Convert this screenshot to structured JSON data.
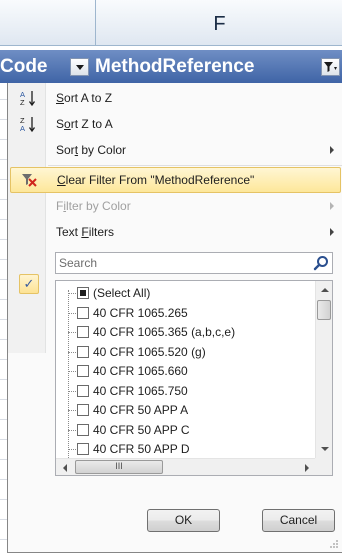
{
  "column_header": {
    "letter": "F"
  },
  "table_header": {
    "code_label": "Code",
    "method_label": "MethodReference"
  },
  "menu": {
    "sort_az": {
      "pre": "",
      "key": "S",
      "post": "ort A to Z"
    },
    "sort_za": {
      "pre": "S",
      "key": "o",
      "post": "rt Z to A"
    },
    "sort_color": {
      "pre": "Sor",
      "key": "t",
      "post": " by Color"
    },
    "clear_filter": {
      "pre": "",
      "key": "C",
      "post": "lear Filter From \"MethodReference\""
    },
    "filter_color": {
      "pre": "F",
      "key": "i",
      "post": "lter by Color"
    },
    "text_filters": {
      "pre": "",
      "key": "",
      "text": "Text ",
      "key2": "F",
      "post": "ilters"
    },
    "search": {
      "placeholder": "Search"
    },
    "list_items": [
      {
        "label": "(Select All)",
        "state": "partial"
      },
      {
        "label": "40 CFR 1065.265",
        "state": "unchecked"
      },
      {
        "label": "40 CFR 1065.365 (a,b,c,e)",
        "state": "unchecked"
      },
      {
        "label": "40 CFR 1065.520 (g)",
        "state": "unchecked"
      },
      {
        "label": "40 CFR 1065.660",
        "state": "unchecked"
      },
      {
        "label": "40 CFR 1065.750",
        "state": "unchecked"
      },
      {
        "label": "40 CFR 50 APP A",
        "state": "unchecked"
      },
      {
        "label": "40 CFR 50 APP C",
        "state": "unchecked"
      },
      {
        "label": "40 CFR 50 APP D",
        "state": "unchecked"
      }
    ],
    "scroll_thumb_glyph": "III",
    "ok_label": "OK",
    "cancel_label": "Cancel"
  },
  "colors": {
    "header_blue": "#4f72b4",
    "hover_yellow": "#fde79a",
    "disabled_text": "#a0a0a0"
  }
}
